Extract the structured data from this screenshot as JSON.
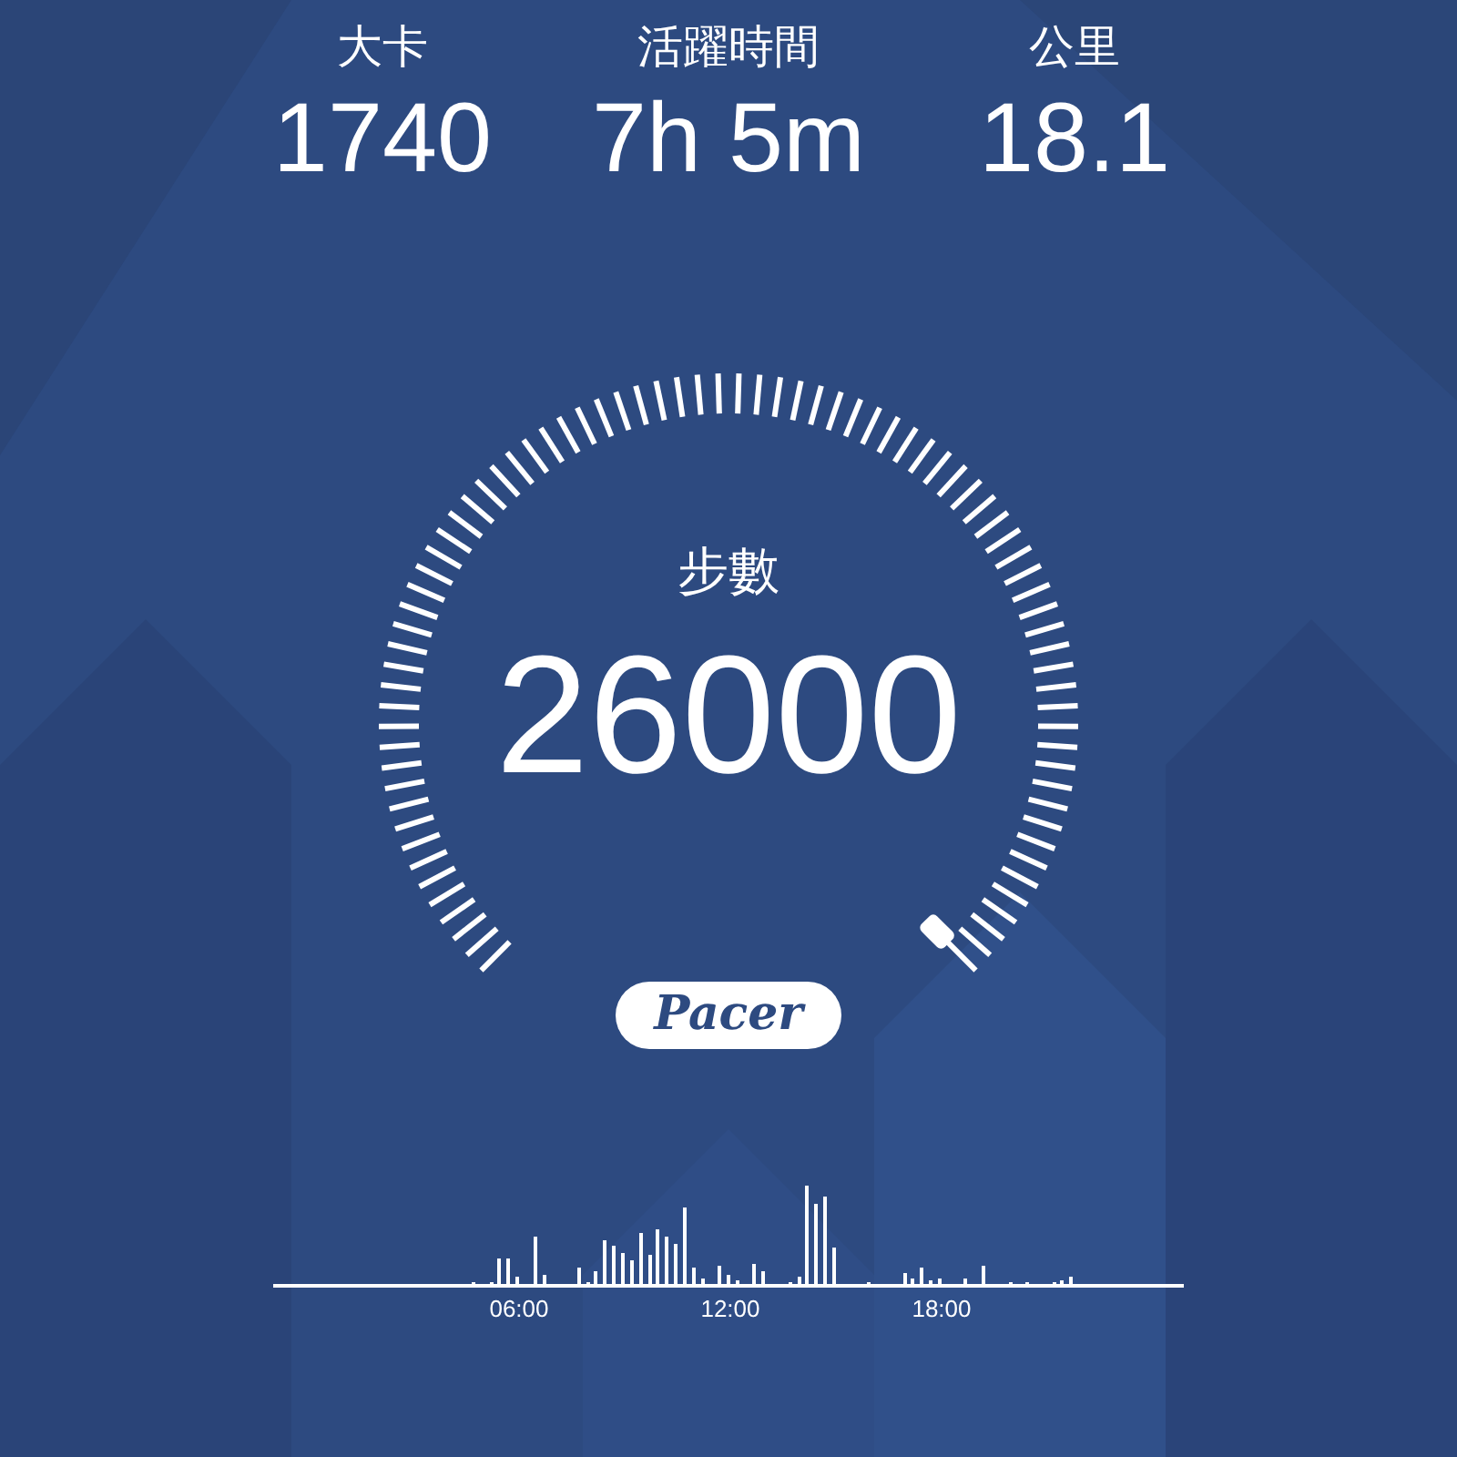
{
  "stats": [
    {
      "label": "大卡",
      "value": "1740"
    },
    {
      "label": "活躍時間",
      "value": "7h 5m"
    },
    {
      "label": "公里",
      "value": "18.1"
    }
  ],
  "gauge": {
    "label": "步數",
    "value": "26000"
  },
  "logo": "Pacer",
  "activity_chart": {
    "time_labels": [
      "06:00",
      "12:00",
      "18:00"
    ]
  }
}
